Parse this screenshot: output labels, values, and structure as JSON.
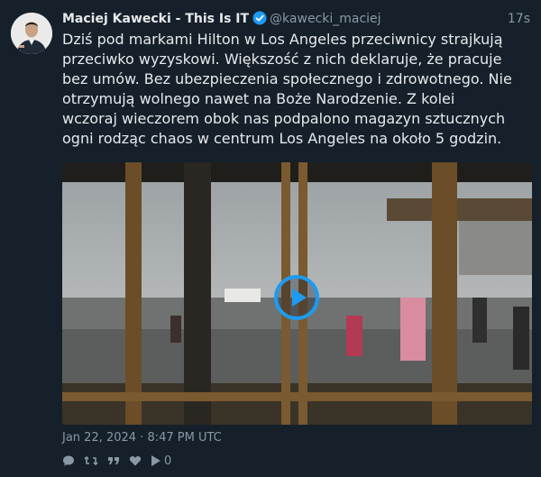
{
  "tweet": {
    "author_name": "Maciej Kawecki - This Is IT",
    "author_handle": "@kawecki_maciej",
    "relative_time": "17s",
    "verified_icon": "verified-badge-icon",
    "lines": [
      "Dziś pod markami Hilton w Los Angeles przeciwnicy strajkują",
      "przeciwko wyzyskowi. Większość z nich deklaruje, że pracuje",
      "bez umów. Bez ubezpieczenia społecznego i zdrowotnego. Nie",
      "otrzymują wolnego nawet na Boże Narodzenie. Z kolei",
      "wczoraj wieczorem obok nas podpalono magazyn sztucznych",
      "ogni rodząc chaos w centrum Los Angeles na około 5 godzin."
    ],
    "timestamp": "Jan 22, 2024 · 8:47 PM UTC",
    "play_count": "0"
  },
  "icons": [
    "reply-icon",
    "retweet-icon",
    "quote-icon",
    "like-icon",
    "play-count-icon",
    "play-button-icon"
  ],
  "colors": {
    "background": "#15202b",
    "accent": "#1d9bf0",
    "muted": "#8b98a5",
    "text": "#e7e9ea"
  }
}
